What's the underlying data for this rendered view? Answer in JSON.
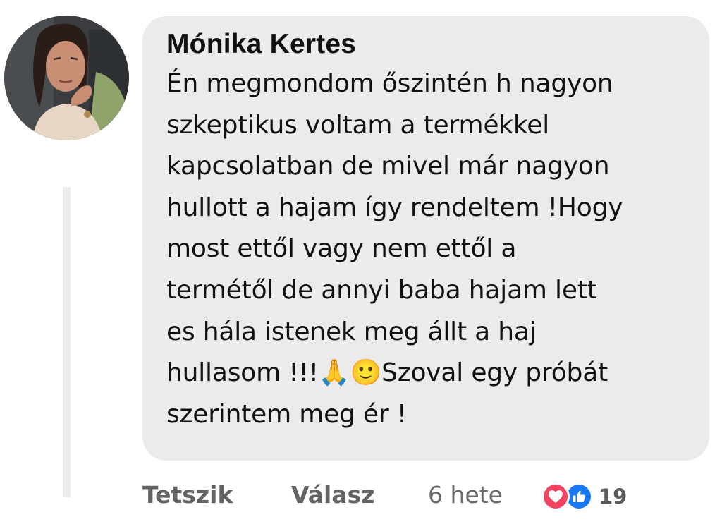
{
  "comment": {
    "author": "Mónika Kertes",
    "text": "Én megmondom őszintén h nagyon\nszkeptikus voltam a termékkel\nkapcsolatban de mivel már nagyon\nhullott a hajam így rendeltem !Hogy\nmost ettől vagy nem ettől a\ntermétől de annyi baba hajam lett\nes hála istenek meg állt a haj\nhullasom !!!🙏🙂Szoval egy próbát\nszerintem meg ér !"
  },
  "actions": {
    "like_label": "Tetszik",
    "reply_label": "Válasz",
    "timestamp": "6 hete"
  },
  "reactions": {
    "icons": [
      "love-icon",
      "like-icon"
    ],
    "count": "19",
    "colors": {
      "love": "#f3425f",
      "like": "#1877f2"
    }
  },
  "colors": {
    "bubble": "#ebebeb",
    "text": "#111111",
    "action_text": "#636363"
  }
}
